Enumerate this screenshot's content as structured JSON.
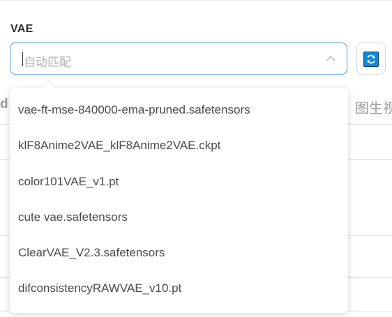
{
  "vae_field": {
    "label": "VAE",
    "placeholder": "自动匹配",
    "expanded_icon": "chevron-up-icon"
  },
  "refresh": {
    "icon": "refresh-icon",
    "accent": "#0f88d6"
  },
  "background": {
    "left_fragment": "d",
    "right_fragment": "图生视"
  },
  "dropdown": {
    "options": [
      "vae-ft-mse-840000-ema-pruned.safetensors",
      "klF8Anime2VAE_klF8Anime2VAE.ckpt",
      "color101VAE_v1.pt",
      "cute vae.safetensors",
      "ClearVAE_V2.3.safetensors",
      "difconsistencyRAWVAE_v10.pt"
    ]
  },
  "colors": {
    "focus_border": "#4c9be8",
    "placeholder": "#b5b5b5",
    "option_text": "#4a4a4a"
  }
}
